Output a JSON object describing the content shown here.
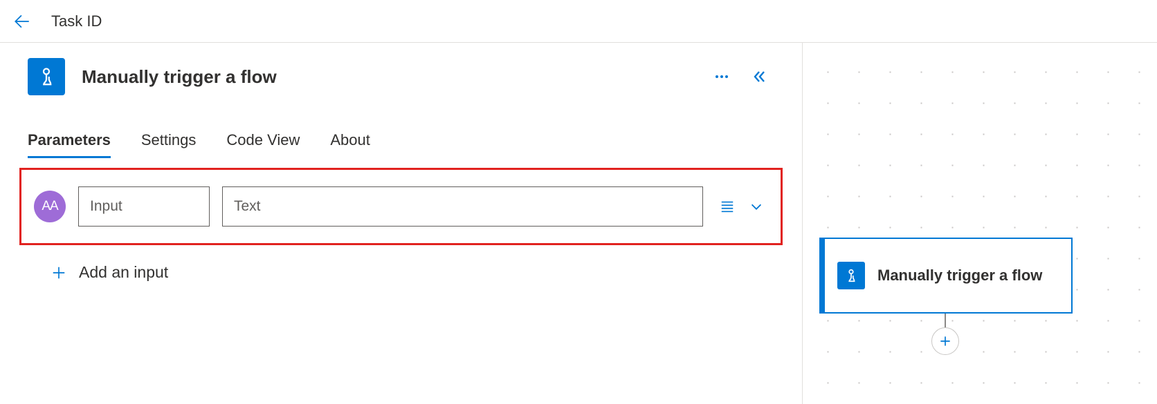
{
  "header": {
    "title": "Task ID"
  },
  "panel": {
    "title": "Manually trigger a flow",
    "tabs": [
      {
        "label": "Parameters",
        "active": true
      },
      {
        "label": "Settings",
        "active": false
      },
      {
        "label": "Code View",
        "active": false
      },
      {
        "label": "About",
        "active": false
      }
    ],
    "input_row": {
      "type_label": "AA",
      "name_value": "Input",
      "value_placeholder": "Text"
    },
    "add_input_label": "Add an input"
  },
  "canvas": {
    "card_label": "Manually trigger a flow"
  }
}
